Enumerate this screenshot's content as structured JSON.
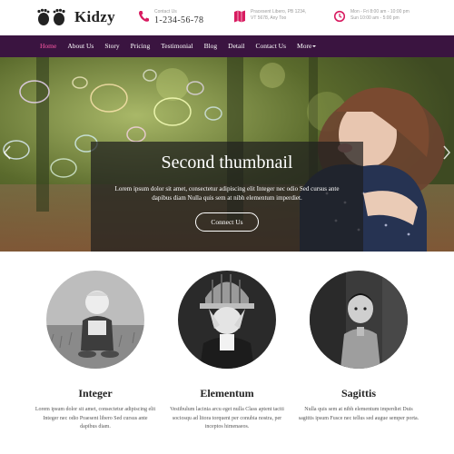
{
  "brand": {
    "name": "Kidzy"
  },
  "header": {
    "phone": {
      "label": "Contact Us",
      "value": "1-234-56-78"
    },
    "address": {
      "line1": "Pracesent Libero, PB 1234,",
      "line2": "VT 5678, Any Too"
    },
    "hours": {
      "line1": "Mon - Fri 8:00 am - 10:00 pm",
      "line2": "Sun 10:00 am - 5:00 pm"
    }
  },
  "nav": {
    "items": [
      "Home",
      "About Us",
      "Story",
      "Pricing",
      "Testimonial",
      "Blog",
      "Detail",
      "Contact Us"
    ],
    "more_label": "More",
    "active": "Home"
  },
  "hero": {
    "title": "Second thumbnail",
    "text": "Lorem ipsum dolor sit amet, consectetur adipiscing elit Integer nec odio Sed cursus ante dapibus diam Nulla quis sem at nibh elementum imperdiet.",
    "button_label": "Connect Us"
  },
  "features": [
    {
      "title": "Integer",
      "text": "Lorem ipsum dolor sit amet, consectetur adipiscing elit Integer nec odio Praesent libero Sed cursus ante dapibus diam."
    },
    {
      "title": "Elementum",
      "text": "Vestibulum lacinia arcu eget nulla Class aptent taciti sociosqu ad litora torquent per conubia nostra, per inceptos himenaeos."
    },
    {
      "title": "Sagittis",
      "text": "Nulla quis sem at nibh elementum imperdiet Duis sagittis ipsum Fusce nec tellus sed augue semper porta."
    }
  ],
  "colors": {
    "nav_bg": "#3a1440",
    "accent": "#ff5aa7",
    "icon": "#d81b60"
  }
}
